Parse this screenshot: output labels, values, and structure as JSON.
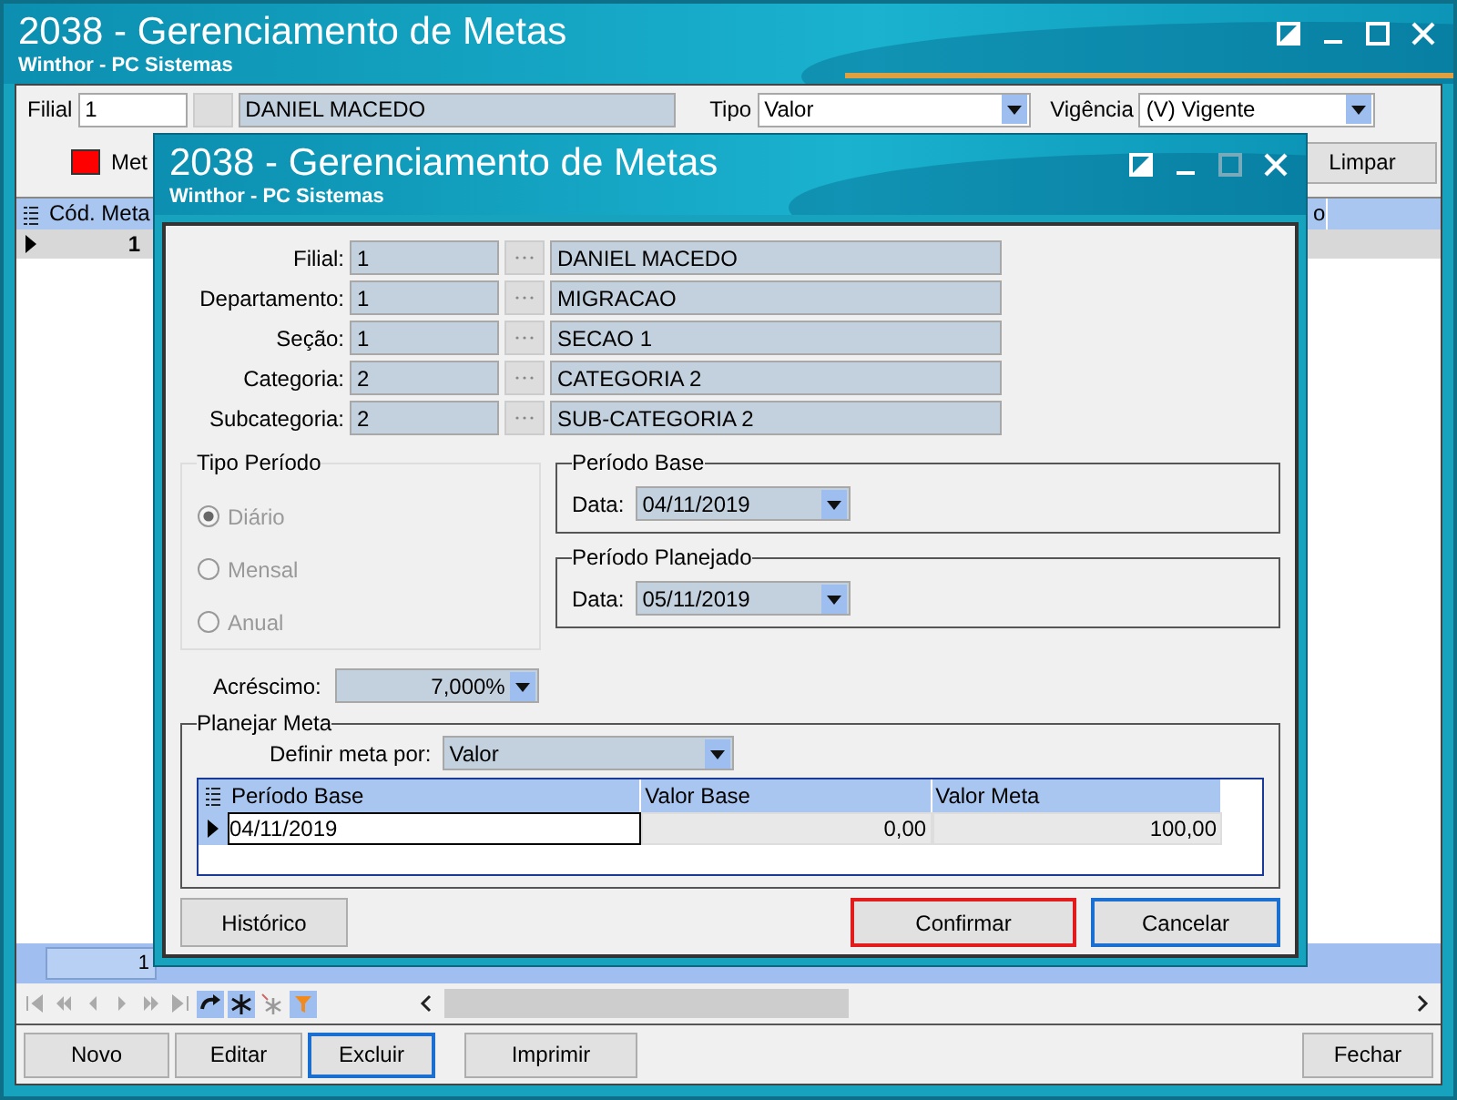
{
  "main_window": {
    "title": "2038 - Gerenciamento de Metas",
    "subtitle": "Winthor - PC Sistemas",
    "filters": {
      "filial_label": "Filial",
      "filial_code": "1",
      "filial_name": "DANIEL MACEDO",
      "tipo_label": "Tipo",
      "tipo_value": "Valor",
      "vigencia_label": "Vigência",
      "vigencia_value": "(V) Vigente"
    },
    "legend": {
      "color": "#ff0000",
      "label": "Met"
    },
    "clear_button": "Limpar",
    "grid": {
      "columns": [
        "Cód. Meta",
        "o"
      ],
      "rows": [
        {
          "cells": [
            "1"
          ],
          "selected": true
        }
      ],
      "summary": "1"
    },
    "buttons": [
      {
        "label": "Novo",
        "focused": false
      },
      {
        "label": "Editar",
        "focused": false
      },
      {
        "label": "Excluir",
        "focused": true
      },
      {
        "label": "Imprimir",
        "focused": false
      },
      {
        "label": "Fechar",
        "focused": false
      }
    ]
  },
  "dialog": {
    "title": "2038 - Gerenciamento de Metas",
    "subtitle": "Winthor - PC Sistemas",
    "fields": [
      {
        "label": "Filial:",
        "code": "1",
        "name": "DANIEL MACEDO"
      },
      {
        "label": "Departamento:",
        "code": "1",
        "name": "MIGRACAO"
      },
      {
        "label": "Seção:",
        "code": "1",
        "name": "SECAO 1"
      },
      {
        "label": "Categoria:",
        "code": "2",
        "name": "CATEGORIA 2"
      },
      {
        "label": "Subcategoria:",
        "code": "2",
        "name": "SUB-CATEGORIA 2"
      }
    ],
    "tipo_periodo": {
      "title": "Tipo Período",
      "disabled": true,
      "options": [
        {
          "label": "Diário",
          "selected": true
        },
        {
          "label": "Mensal",
          "selected": false
        },
        {
          "label": "Anual",
          "selected": false
        }
      ]
    },
    "periodo_base": {
      "title": "Período Base",
      "date_label": "Data:",
      "date": "04/11/2019"
    },
    "periodo_planejado": {
      "title": "Período Planejado",
      "date_label": "Data:",
      "date": "05/11/2019"
    },
    "acrescimo": {
      "label": "Acréscimo:",
      "value": "7,000%"
    },
    "planejar_meta": {
      "title": "Planejar Meta",
      "define_label": "Definir meta por:",
      "define_value": "Valor",
      "columns": [
        "Período Base",
        "Valor Base",
        "Valor Meta"
      ],
      "rows": [
        {
          "cells": [
            "04/11/2019",
            "0,00",
            "100,00"
          ],
          "selected": true
        }
      ]
    },
    "buttons": [
      {
        "label": "Histórico",
        "highlighted": false,
        "focused": false
      },
      {
        "label": "Confirmar",
        "highlighted": true,
        "focused": false
      },
      {
        "label": "Cancelar",
        "highlighted": false,
        "focused": true
      }
    ]
  }
}
